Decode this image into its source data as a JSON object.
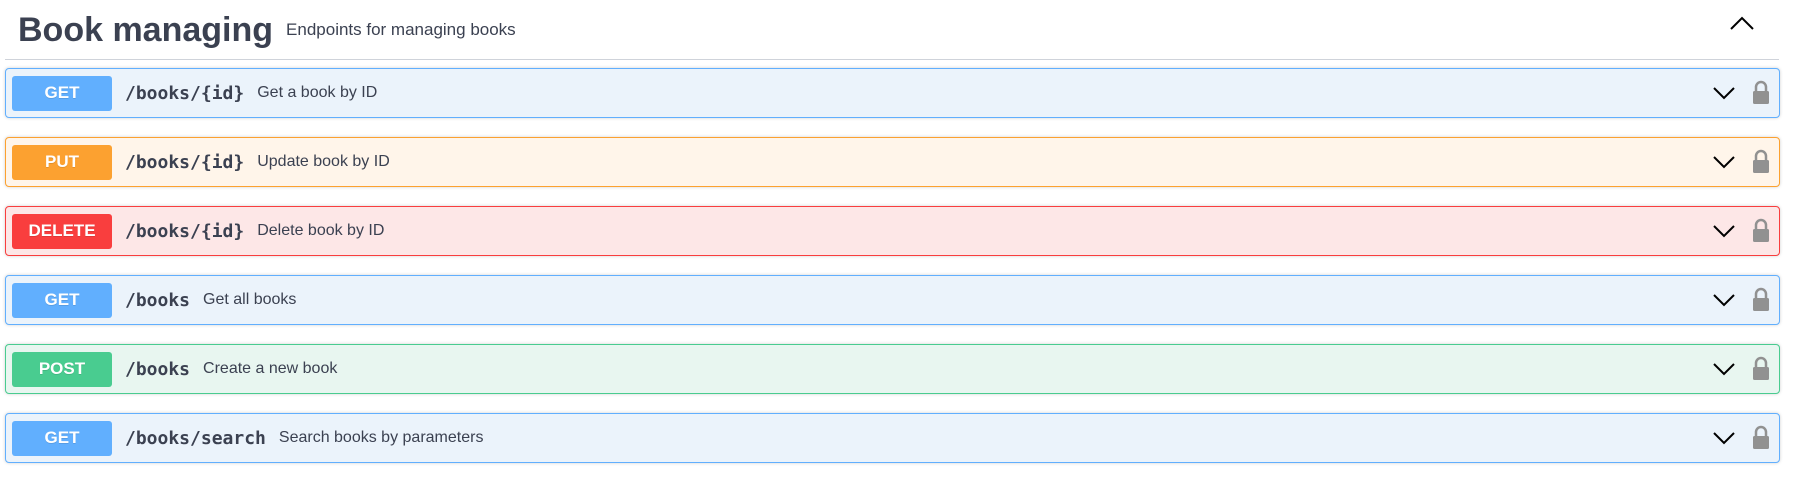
{
  "section": {
    "title": "Book managing",
    "description": "Endpoints for managing books",
    "toggle_icon": "chevron-up-icon"
  },
  "operations": [
    {
      "method": "GET",
      "path": "/books/{id}",
      "summary": "Get a book by ID"
    },
    {
      "method": "PUT",
      "path": "/books/{id}",
      "summary": "Update book by ID"
    },
    {
      "method": "DELETE",
      "path": "/books/{id}",
      "summary": "Delete book by ID"
    },
    {
      "method": "GET",
      "path": "/books",
      "summary": "Get all books"
    },
    {
      "method": "POST",
      "path": "/books",
      "summary": "Create a new book"
    },
    {
      "method": "GET",
      "path": "/books/search",
      "summary": "Search books by parameters"
    }
  ],
  "icons": {
    "expand": "chevron-down-icon",
    "auth": "lock-icon"
  },
  "colors": {
    "GET": "#61affe",
    "PUT": "#fca130",
    "DELETE": "#f93e3e",
    "POST": "#49cc90",
    "text": "#3b4151"
  }
}
